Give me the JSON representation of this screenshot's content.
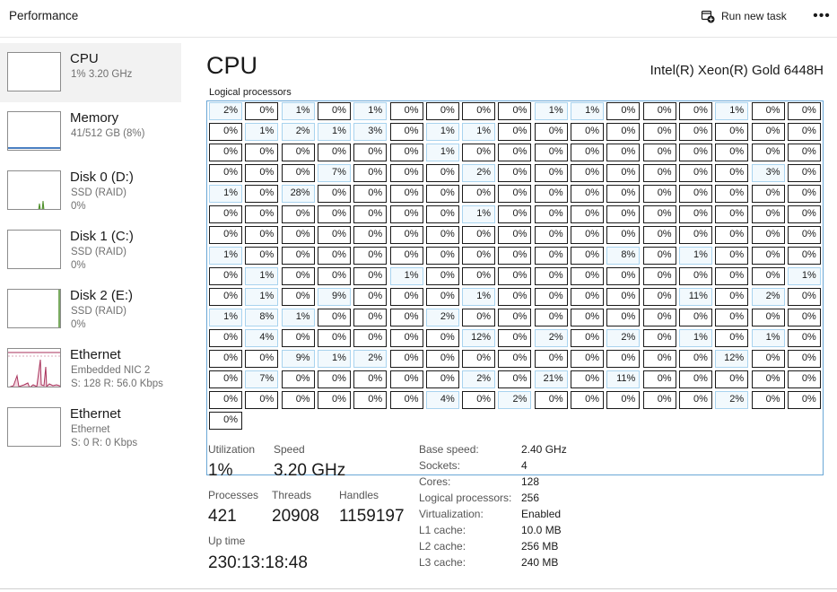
{
  "header": {
    "title": "Performance",
    "run_new_task": "Run new task"
  },
  "sidebar": {
    "items": [
      {
        "name": "CPU",
        "sub1": "1%  3.20 GHz",
        "sub2": "",
        "selected": true
      },
      {
        "name": "Memory",
        "sub1": "41/512 GB (8%)",
        "sub2": ""
      },
      {
        "name": "Disk 0 (D:)",
        "sub1": "SSD (RAID)",
        "sub2": "0%"
      },
      {
        "name": "Disk 1 (C:)",
        "sub1": "SSD (RAID)",
        "sub2": "0%"
      },
      {
        "name": "Disk 2 (E:)",
        "sub1": "SSD (RAID)",
        "sub2": "0%"
      },
      {
        "name": "Ethernet",
        "sub1": "Embedded NIC 2",
        "sub2": "S: 128  R: 56.0 Kbps"
      },
      {
        "name": "Ethernet",
        "sub1": "Ethernet",
        "sub2": "S: 0  R: 0 Kbps"
      }
    ],
    "colors": {
      "memory": "#4a7fc1",
      "disk": "#4d8f2a",
      "ethernet": "#a8325b"
    }
  },
  "main": {
    "title": "CPU",
    "model": "Intel(R) Xeon(R) Gold 6448H",
    "logical_processors_label": "Logical processors",
    "grid": [
      [
        "2%",
        "0%",
        "1%",
        "0%",
        "1%",
        "0%",
        "0%",
        "0%",
        "0%",
        "1%",
        "1%",
        "0%",
        "0%",
        "0%",
        "1%",
        "0%",
        "0%"
      ],
      [
        "0%",
        "1%",
        "2%",
        "1%",
        "3%",
        "0%",
        "1%",
        "1%",
        "0%",
        "0%",
        "0%",
        "0%",
        "0%",
        "0%",
        "0%",
        "0%",
        "0%"
      ],
      [
        "0%",
        "0%",
        "0%",
        "0%",
        "0%",
        "0%",
        "1%",
        "0%",
        "0%",
        "0%",
        "0%",
        "0%",
        "0%",
        "0%",
        "0%",
        "0%",
        "0%"
      ],
      [
        "0%",
        "0%",
        "0%",
        "7%",
        "0%",
        "0%",
        "0%",
        "2%",
        "0%",
        "0%",
        "0%",
        "0%",
        "0%",
        "0%",
        "0%",
        "3%",
        "0%"
      ],
      [
        "1%",
        "0%",
        "28%",
        "0%",
        "0%",
        "0%",
        "0%",
        "0%",
        "0%",
        "0%",
        "0%",
        "0%",
        "0%",
        "0%",
        "0%",
        "0%",
        "0%"
      ],
      [
        "0%",
        "0%",
        "0%",
        "0%",
        "0%",
        "0%",
        "0%",
        "1%",
        "0%",
        "0%",
        "0%",
        "0%",
        "0%",
        "0%",
        "0%",
        "0%",
        "0%"
      ],
      [
        "0%",
        "0%",
        "0%",
        "0%",
        "0%",
        "0%",
        "0%",
        "0%",
        "0%",
        "0%",
        "0%",
        "0%",
        "0%",
        "0%",
        "0%",
        "0%",
        "0%"
      ],
      [
        "1%",
        "0%",
        "0%",
        "0%",
        "0%",
        "0%",
        "0%",
        "0%",
        "0%",
        "0%",
        "0%",
        "8%",
        "0%",
        "1%",
        "0%",
        "0%",
        "0%"
      ],
      [
        "0%",
        "1%",
        "0%",
        "0%",
        "0%",
        "1%",
        "0%",
        "0%",
        "0%",
        "0%",
        "0%",
        "0%",
        "0%",
        "0%",
        "0%",
        "0%",
        "1%"
      ],
      [
        "0%",
        "1%",
        "0%",
        "9%",
        "0%",
        "0%",
        "0%",
        "1%",
        "0%",
        "0%",
        "0%",
        "0%",
        "0%",
        "11%",
        "0%",
        "2%",
        "0%"
      ],
      [
        "1%",
        "8%",
        "1%",
        "0%",
        "0%",
        "0%",
        "2%",
        "0%",
        "0%",
        "0%",
        "0%",
        "0%",
        "0%",
        "0%",
        "0%",
        "0%",
        "0%"
      ],
      [
        "0%",
        "4%",
        "0%",
        "0%",
        "0%",
        "0%",
        "0%",
        "12%",
        "0%",
        "2%",
        "0%",
        "2%",
        "0%",
        "1%",
        "0%",
        "1%",
        "0%"
      ],
      [
        "0%",
        "0%",
        "9%",
        "1%",
        "2%",
        "0%",
        "0%",
        "0%",
        "0%",
        "0%",
        "0%",
        "0%",
        "0%",
        "0%",
        "12%",
        "0%",
        "0%"
      ],
      [
        "0%",
        "7%",
        "0%",
        "0%",
        "0%",
        "0%",
        "0%",
        "2%",
        "0%",
        "21%",
        "0%",
        "11%",
        "0%",
        "0%",
        "0%",
        "0%",
        "0%"
      ],
      [
        "0%",
        "0%",
        "0%",
        "0%",
        "0%",
        "0%",
        "4%",
        "0%",
        "2%",
        "0%",
        "0%",
        "0%",
        "0%",
        "0%",
        "2%",
        "0%",
        "0%"
      ],
      [
        "0%"
      ]
    ],
    "highlight_color": "#a9d3ee"
  },
  "stats": {
    "utilization_label": "Utilization",
    "utilization": "1%",
    "speed_label": "Speed",
    "speed": "3.20 GHz",
    "processes_label": "Processes",
    "processes": "421",
    "threads_label": "Threads",
    "threads": "20908",
    "handles_label": "Handles",
    "handles": "1159197",
    "uptime_label": "Up time",
    "uptime": "230:13:18:48"
  },
  "specs": [
    {
      "k": "Base speed:",
      "v": "2.40 GHz"
    },
    {
      "k": "Sockets:",
      "v": "4"
    },
    {
      "k": "Cores:",
      "v": "128"
    },
    {
      "k": "Logical processors:",
      "v": "256"
    },
    {
      "k": "Virtualization:",
      "v": "Enabled"
    },
    {
      "k": "L1 cache:",
      "v": "10.0 MB"
    },
    {
      "k": "L2 cache:",
      "v": "256 MB"
    },
    {
      "k": "L3 cache:",
      "v": "240 MB"
    }
  ]
}
